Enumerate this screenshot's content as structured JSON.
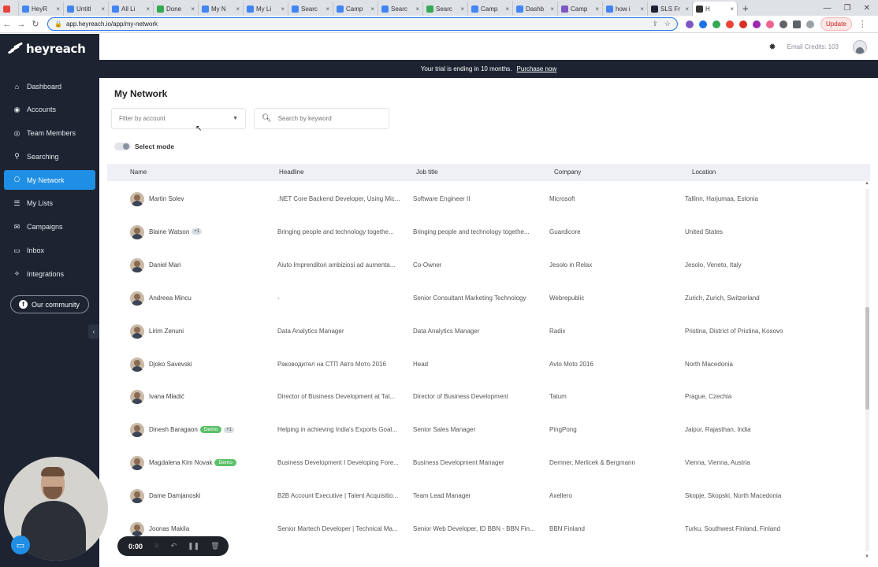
{
  "browser": {
    "tabs": [
      {
        "label": "",
        "color": "#e8453c",
        "active": false
      },
      {
        "label": "HeyR",
        "color": "#4285f4",
        "active": false
      },
      {
        "label": "Untitl",
        "color": "#4285f4",
        "active": false
      },
      {
        "label": "All Li",
        "color": "#4285f4",
        "active": false
      },
      {
        "label": "Done",
        "color": "#34a853",
        "active": false
      },
      {
        "label": "My N",
        "color": "#4285f4",
        "active": false
      },
      {
        "label": "My Li",
        "color": "#4285f4",
        "active": false
      },
      {
        "label": "Searc",
        "color": "#4285f4",
        "active": false
      },
      {
        "label": "Camp",
        "color": "#4285f4",
        "active": false
      },
      {
        "label": "Searc",
        "color": "#4285f4",
        "active": false
      },
      {
        "label": "Searc",
        "color": "#34a853",
        "active": false
      },
      {
        "label": "Camp",
        "color": "#4285f4",
        "active": false
      },
      {
        "label": "Dashb",
        "color": "#4285f4",
        "active": false
      },
      {
        "label": "Camp",
        "color": "#7e57c2",
        "active": false
      },
      {
        "label": "how i",
        "color": "#4285f4",
        "active": false
      },
      {
        "label": "SLS Fr",
        "color": "#1d2331",
        "active": false
      },
      {
        "label": "H",
        "color": "#333333",
        "active": true
      }
    ],
    "url": "app.heyreach.io/app/my-network",
    "update_label": "Update"
  },
  "sidebar": {
    "brand": "heyreach",
    "items": [
      {
        "label": "Dashboard",
        "icon": "home-icon",
        "active": false
      },
      {
        "label": "Accounts",
        "icon": "user-circle-icon",
        "active": false
      },
      {
        "label": "Team Members",
        "icon": "globe-icon",
        "active": false
      },
      {
        "label": "Searching",
        "icon": "search-icon",
        "active": false
      },
      {
        "label": "My Network",
        "icon": "network-icon",
        "active": true
      },
      {
        "label": "My Lists",
        "icon": "list-icon",
        "active": false
      },
      {
        "label": "Campaigns",
        "icon": "megaphone-icon",
        "active": false
      },
      {
        "label": "Inbox",
        "icon": "inbox-icon",
        "active": false
      },
      {
        "label": "Integrations",
        "icon": "integrations-icon",
        "active": false
      }
    ],
    "community_label": "Our community"
  },
  "header": {
    "credits": "Email Credits: 103"
  },
  "trial": {
    "message": "Your trial is ending in 10 months.",
    "cta": "Purchase now"
  },
  "page": {
    "title": "My Network",
    "filter_placeholder": "Filter by account",
    "search_placeholder": "Search by keyword",
    "select_mode_label": "Select mode"
  },
  "table": {
    "columns": {
      "name": "Name",
      "headline": "Headline",
      "job_title": "Job title",
      "company": "Company",
      "location": "Location"
    },
    "rows": [
      {
        "name": "Martin Solev",
        "demo": "",
        "count": "",
        "headline": ".NET Core Backend Developer, Using Mic...",
        "job_title": "Software Engineer II",
        "company": "Microsoft",
        "location": "Tallinn, Harjumaa, Estonia"
      },
      {
        "name": "Blaine Watson",
        "demo": "",
        "count": "+1",
        "headline": "Bringing people and technology togethe...",
        "job_title": "Bringing people and technology togethe...",
        "company": "Guardicore",
        "location": "United States"
      },
      {
        "name": "Daniel Mari",
        "demo": "",
        "count": "",
        "headline": "Aiuto Imprenditori ambiziosi ad aumenta...",
        "job_title": "Co-Owner",
        "company": "Jesolo in Relax",
        "location": "Jesolo, Veneto, Italy"
      },
      {
        "name": "Andreea Mincu",
        "demo": "",
        "count": "",
        "headline": "-",
        "job_title": "Senior Consultant Marketing Technology",
        "company": "Webrepublic",
        "location": "Zurich, Zurich, Switzerland"
      },
      {
        "name": "Lirim Zenuni",
        "demo": "",
        "count": "",
        "headline": "Data Analytics Manager",
        "job_title": "Data Analytics Manager",
        "company": "Radix",
        "location": "Pristina, District of Pristina, Kosovo"
      },
      {
        "name": "Djoko Savevski",
        "demo": "",
        "count": "",
        "headline": "Раководител на СТП Авто Мото 2016",
        "job_title": "Head",
        "company": "Avto Moto 2016",
        "location": "North Macedonia"
      },
      {
        "name": "Ivana Mladić",
        "demo": "",
        "count": "",
        "headline": "Director of Business Development at Tat...",
        "job_title": "Director of Business Development",
        "company": "Tatum",
        "location": "Prague, Czechia"
      },
      {
        "name": "Dinesh Baragaon",
        "demo": "Demo",
        "count": "+1",
        "headline": "Helping in achieving India's Exports Goal...",
        "job_title": "Senior Sales Manager",
        "company": "PingPong",
        "location": "Jaipur, Rajasthan, India"
      },
      {
        "name": "Magdalena Kim Novak",
        "demo": "Demo",
        "count": "",
        "headline": "Business Development I Developing Fore...",
        "job_title": "Business Development Manager",
        "company": "Demner, Merlicek & Bergmann",
        "location": "Vienna, Vienna, Austria"
      },
      {
        "name": "Dame Damjanoski",
        "demo": "",
        "count": "",
        "headline": "B2B Account Executive | Talent Acquisitio...",
        "job_title": "Team Lead Manager",
        "company": "Axellero",
        "location": "Skopje, Skopski, North Macedonia"
      },
      {
        "name": "Joonas Makila",
        "demo": "",
        "count": "",
        "headline": "Senior Martech Developer | Technical Ma...",
        "job_title": "Senior Web Developer, ID BBN - BBN Fin...",
        "company": "BBN Finland",
        "location": "Turku, Southwest Finland, Finland"
      }
    ]
  },
  "recorder": {
    "time": "0:00"
  }
}
